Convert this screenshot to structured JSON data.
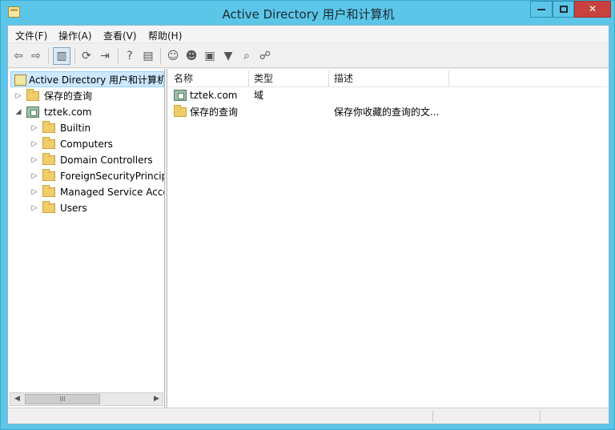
{
  "window": {
    "title": "Active Directory 用户和计算机"
  },
  "menu": {
    "items": [
      "文件(F)",
      "操作(A)",
      "查看(V)",
      "帮助(H)"
    ]
  },
  "toolbar": {
    "icons": [
      "back-arrow-icon",
      "forward-arrow-icon",
      "show-hide-console-tree-icon",
      "refresh-icon",
      "export-list-icon",
      "help-icon",
      "show-hide-action-pane-icon",
      "create-user-icon",
      "create-group-icon",
      "create-ou-icon",
      "filter-icon",
      "find-icon",
      "add-to-group-icon"
    ]
  },
  "tree": {
    "root": "Active Directory 用户和计算机",
    "saved_queries": "保存的查询",
    "domain": "tztek.com",
    "children": [
      "Builtin",
      "Computers",
      "Domain Controllers",
      "ForeignSecurityPrincipa",
      "Managed Service Acco",
      "Users"
    ]
  },
  "list": {
    "columns": [
      "名称",
      "类型",
      "描述"
    ],
    "rows": [
      {
        "name": "tztek.com",
        "type": "域",
        "description": "",
        "icon": "domain-icon"
      },
      {
        "name": "保存的查询",
        "type": "",
        "description": "保存你收藏的查询的文...",
        "icon": "folder-icon"
      }
    ]
  },
  "scrollbar": {
    "thumb_glyph": "III"
  },
  "colors": {
    "titlebar": "#5bc6e8",
    "close_button": "#c7423f",
    "selection": "#cde8ff"
  }
}
